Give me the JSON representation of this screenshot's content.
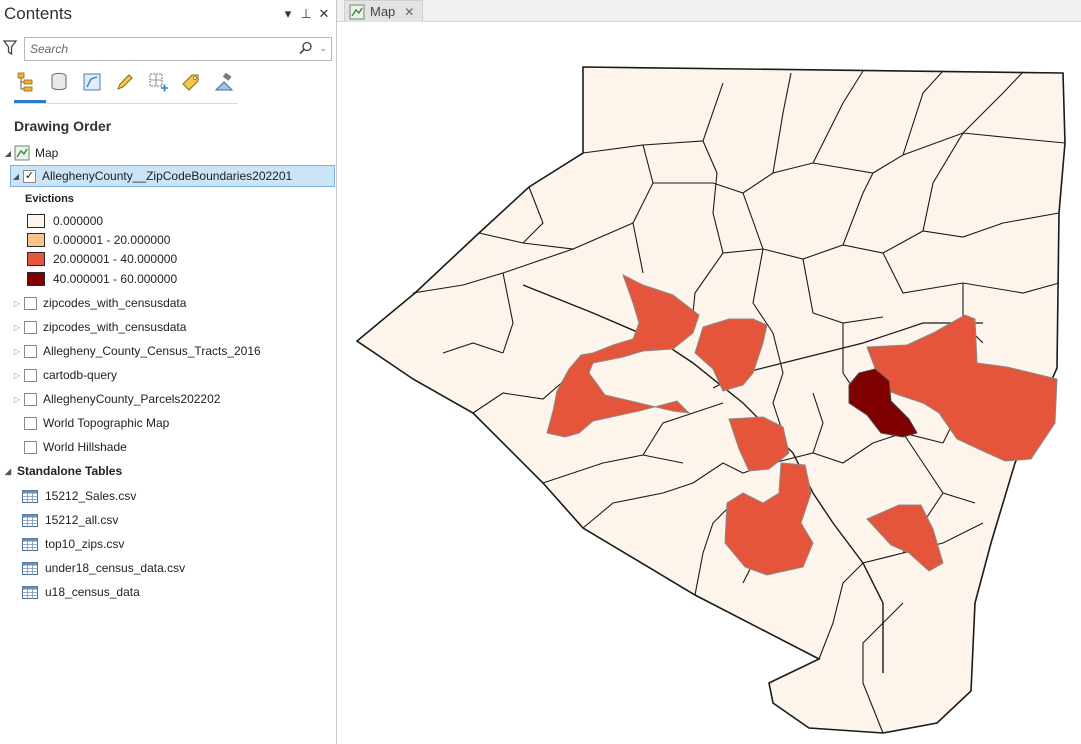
{
  "contents_pane": {
    "title": "Contents",
    "search_placeholder": "Search",
    "section_title": "Drawing Order",
    "map_node": "Map",
    "selected_layer": "AlleghenyCounty__ZipCodeBoundaries202201",
    "legend": {
      "field": "Evictions",
      "classes": [
        {
          "label": "0.000000",
          "color": "#fdf5ec"
        },
        {
          "label": "0.000001 - 20.000000",
          "color": "#fbc28d"
        },
        {
          "label": "20.000001 - 40.000000",
          "color": "#e4553b"
        },
        {
          "label": "40.000001 - 60.000000",
          "color": "#7f0000"
        }
      ]
    },
    "layers": [
      {
        "name": "zipcodes_with_censusdata"
      },
      {
        "name": "zipcodes_with_censusdata"
      },
      {
        "name": "Allegheny_County_Census_Tracts_2016"
      },
      {
        "name": "cartodb-query"
      },
      {
        "name": "AlleghenyCounty_Parcels202202"
      },
      {
        "name": "World Topographic Map"
      },
      {
        "name": "World Hillshade"
      }
    ],
    "standalone_tables_label": "Standalone Tables",
    "tables": [
      {
        "name": "15212_Sales.csv"
      },
      {
        "name": "15212_all.csv"
      },
      {
        "name": "top10_zips.csv"
      },
      {
        "name": "under18_census_data.csv"
      },
      {
        "name": "u18_census_data"
      }
    ]
  },
  "map_view": {
    "tab_label": "Map",
    "outline_color": "#1a1a1a"
  }
}
